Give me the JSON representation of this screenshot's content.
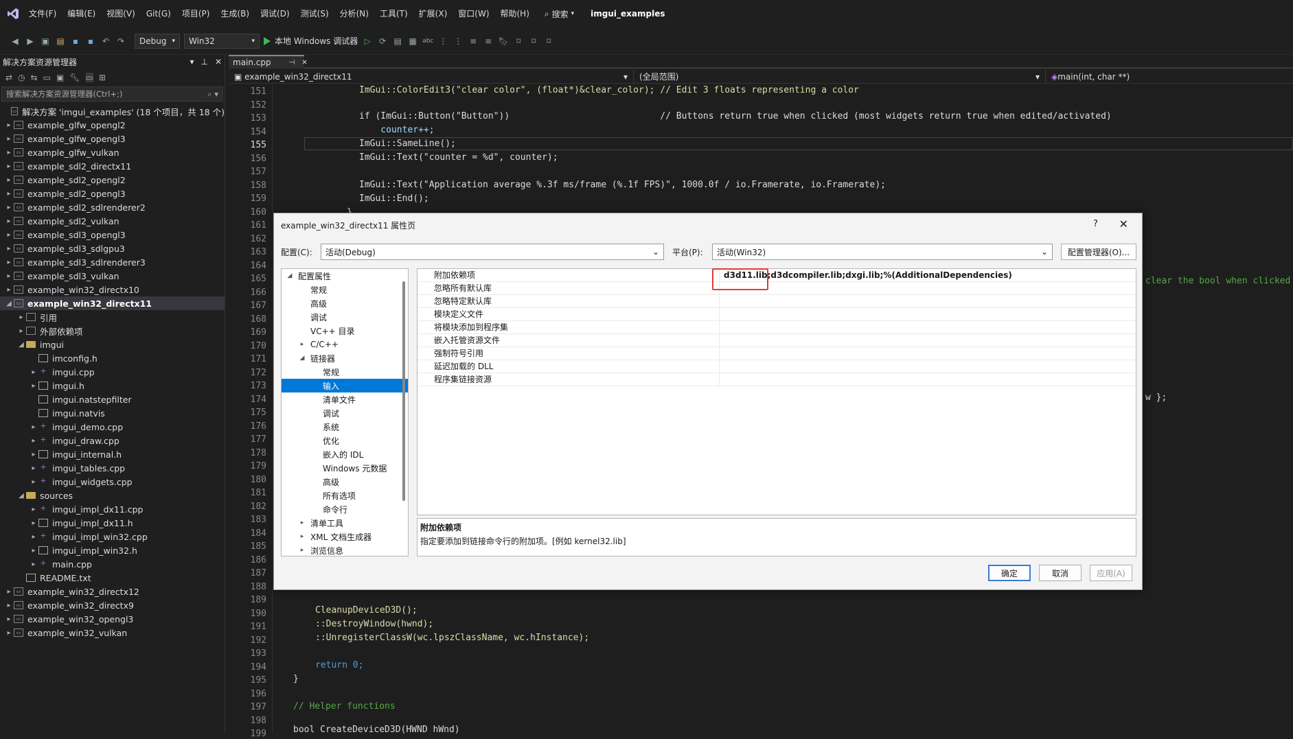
{
  "menu": [
    "文件(F)",
    "编辑(E)",
    "视图(V)",
    "Git(G)",
    "项目(P)",
    "生成(B)",
    "调试(D)",
    "测试(S)",
    "分析(N)",
    "工具(T)",
    "扩展(X)",
    "窗口(W)",
    "帮助(H)"
  ],
  "search_label": "搜索",
  "solution_title": "imgui_examples",
  "toolbar": {
    "config": "Debug",
    "platform": "Win32",
    "run_label": "本地 Windows 调试器"
  },
  "explorer": {
    "title": "解决方案资源管理器",
    "search_placeholder": "搜索解决方案资源管理器(Ctrl+;)",
    "solution_node": "解决方案 'imgui_examples' (18 个项目，共 18 个)",
    "items": [
      "example_glfw_opengl2",
      "example_glfw_opengl3",
      "example_glfw_vulkan",
      "example_sdl2_directx11",
      "example_sdl2_opengl2",
      "example_sdl2_opengl3",
      "example_sdl2_sdlrenderer2",
      "example_sdl2_vulkan",
      "example_sdl3_opengl3",
      "example_sdl3_sdlgpu3",
      "example_sdl3_sdlrenderer3",
      "example_sdl3_vulkan",
      "example_win32_directx10",
      "example_win32_directx11",
      "引用",
      "外部依赖项",
      "imgui",
      "imconfig.h",
      "imgui.cpp",
      "imgui.h",
      "imgui.natstepfilter",
      "imgui.natvis",
      "imgui_demo.cpp",
      "imgui_draw.cpp",
      "imgui_internal.h",
      "imgui_tables.cpp",
      "imgui_widgets.cpp",
      "sources",
      "imgui_impl_dx11.cpp",
      "imgui_impl_dx11.h",
      "imgui_impl_win32.cpp",
      "imgui_impl_win32.h",
      "main.cpp",
      "README.txt",
      "example_win32_directx12",
      "example_win32_directx9",
      "example_win32_opengl3",
      "example_win32_vulkan"
    ]
  },
  "editor": {
    "tab": "main.cpp",
    "nav_project": "example_win32_directx11",
    "nav_scope": "(全局范围)",
    "nav_func": "main(int, char **)",
    "lines": [
      151,
      152,
      153,
      154,
      155,
      156,
      157,
      158,
      159,
      160,
      161,
      162,
      163,
      164,
      165,
      166,
      167,
      168,
      169,
      170,
      171,
      172,
      173,
      174,
      175,
      176,
      177,
      178,
      179,
      180,
      181,
      182,
      183,
      184,
      185,
      186,
      187,
      188,
      189,
      190,
      191,
      192,
      193,
      194,
      195,
      196,
      197,
      198,
      199
    ],
    "current_line": 155
  },
  "dialog": {
    "title": "example_win32_directx11 属性页",
    "help": "?",
    "config_label": "配置(C):",
    "config_value": "活动(Debug)",
    "platform_label": "平台(P):",
    "platform_value": "活动(Win32)",
    "config_manager": "配置管理器(O)...",
    "tree": [
      "配置属性",
      "常规",
      "高级",
      "调试",
      "VC++ 目录",
      "C/C++",
      "链接器",
      "常规",
      "输入",
      "清单文件",
      "调试",
      "系统",
      "优化",
      "嵌入的 IDL",
      "Windows 元数据",
      "高级",
      "所有选项",
      "命令行",
      "清单工具",
      "XML 文档生成器",
      "浏览信息"
    ],
    "props": [
      {
        "k": "附加依赖项",
        "v": "d3d11.lib;d3dcompiler.lib;dxgi.lib;%(AdditionalDependencies)"
      },
      {
        "k": "忽略所有默认库",
        "v": ""
      },
      {
        "k": "忽略特定默认库",
        "v": ""
      },
      {
        "k": "模块定义文件",
        "v": ""
      },
      {
        "k": "将模块添加到程序集",
        "v": ""
      },
      {
        "k": "嵌入托管资源文件",
        "v": ""
      },
      {
        "k": "强制符号引用",
        "v": ""
      },
      {
        "k": "延迟加载的 DLL",
        "v": ""
      },
      {
        "k": "程序集链接资源",
        "v": ""
      }
    ],
    "desc_title": "附加依赖项",
    "desc_text": "指定要添加到链接命令行的附加项。[例如 kernel32.lib]",
    "ok": "确定",
    "cancel": "取消",
    "apply": "应用(A)"
  },
  "code": {
    "l151": "ImGui::ColorEdit3(\"clear color\", (float*)&clear_color); // Edit 3 floats representing a color",
    "l153": "if (ImGui::Button(\"Button\"))                            // Buttons return true when clicked (most widgets return true when edited/activated)",
    "l154": "    counter++;",
    "l155": "ImGui::SameLine();",
    "l156": "ImGui::Text(\"counter = %d\", counter);",
    "l158": "ImGui::Text(\"Application average %.3f ms/frame (%.1f FPS)\", 1000.0f / io.Framerate, io.Framerate);",
    "l159": "ImGui::End();",
    "l160": "}",
    "l165": "clear the bool when clicked",
    "l174": "w };",
    "l190": "CleanupDeviceD3D();",
    "l191": "::DestroyWindow(hwnd);",
    "l192": "::UnregisterClassW(wc.lpszClassName, wc.hInstance);",
    "l194": "return 0;",
    "l195": "}",
    "l197": "// Helper functions",
    "l199": "bool CreateDeviceD3D(HWND hWnd)"
  }
}
